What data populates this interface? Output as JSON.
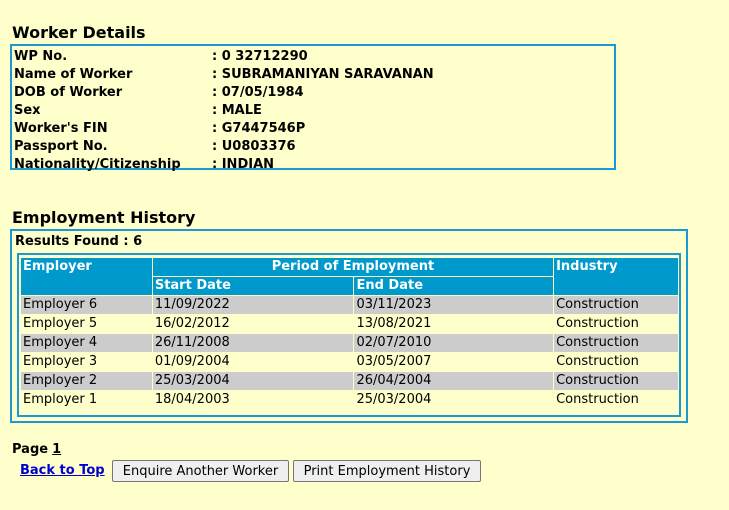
{
  "worker_details": {
    "title": "Worker Details",
    "fields": [
      {
        "label": "WP No.",
        "value": ": 0 32712290"
      },
      {
        "label": "Name of Worker",
        "value": ": SUBRAMANIYAN SARAVANAN"
      },
      {
        "label": "DOB of Worker",
        "value": ": 07/05/1984"
      },
      {
        "label": "Sex",
        "value": ": MALE"
      },
      {
        "label": "Worker's FIN",
        "value": ": G7447546P"
      },
      {
        "label": "Passport No.",
        "value": ": U0803376"
      },
      {
        "label": "Nationality/Citizenship",
        "value": ": INDIAN"
      }
    ]
  },
  "employment_history": {
    "title": "Employment History",
    "results_found": "Results Found : 6",
    "headers": {
      "employer": "Employer",
      "period": "Period of Employment",
      "start_date": "Start Date",
      "end_date": "End Date",
      "industry": "Industry"
    },
    "rows": [
      {
        "employer": "Employer 6",
        "start": "11/09/2022",
        "end": "03/11/2023",
        "industry": "Construction"
      },
      {
        "employer": "Employer 5",
        "start": "16/02/2012",
        "end": "13/08/2021",
        "industry": "Construction"
      },
      {
        "employer": "Employer 4",
        "start": "26/11/2008",
        "end": "02/07/2010",
        "industry": "Construction"
      },
      {
        "employer": "Employer 3",
        "start": "01/09/2004",
        "end": "03/05/2007",
        "industry": "Construction"
      },
      {
        "employer": "Employer 2",
        "start": "25/03/2004",
        "end": "26/04/2004",
        "industry": "Construction"
      },
      {
        "employer": "Employer 1",
        "start": "18/04/2003",
        "end": "25/03/2004",
        "industry": "Construction"
      }
    ]
  },
  "pagination": {
    "label": "Page",
    "current": "1"
  },
  "actions": {
    "back_to_top": "Back to Top",
    "enquire_another": "Enquire Another Worker",
    "print_history": "Print Employment History"
  },
  "colors": {
    "page_background": "#ffffcc",
    "border_accent": "#1a99d4",
    "header_background": "#0099cc",
    "row_alt_background": "#cccccc",
    "link_color": "#0000cc"
  }
}
